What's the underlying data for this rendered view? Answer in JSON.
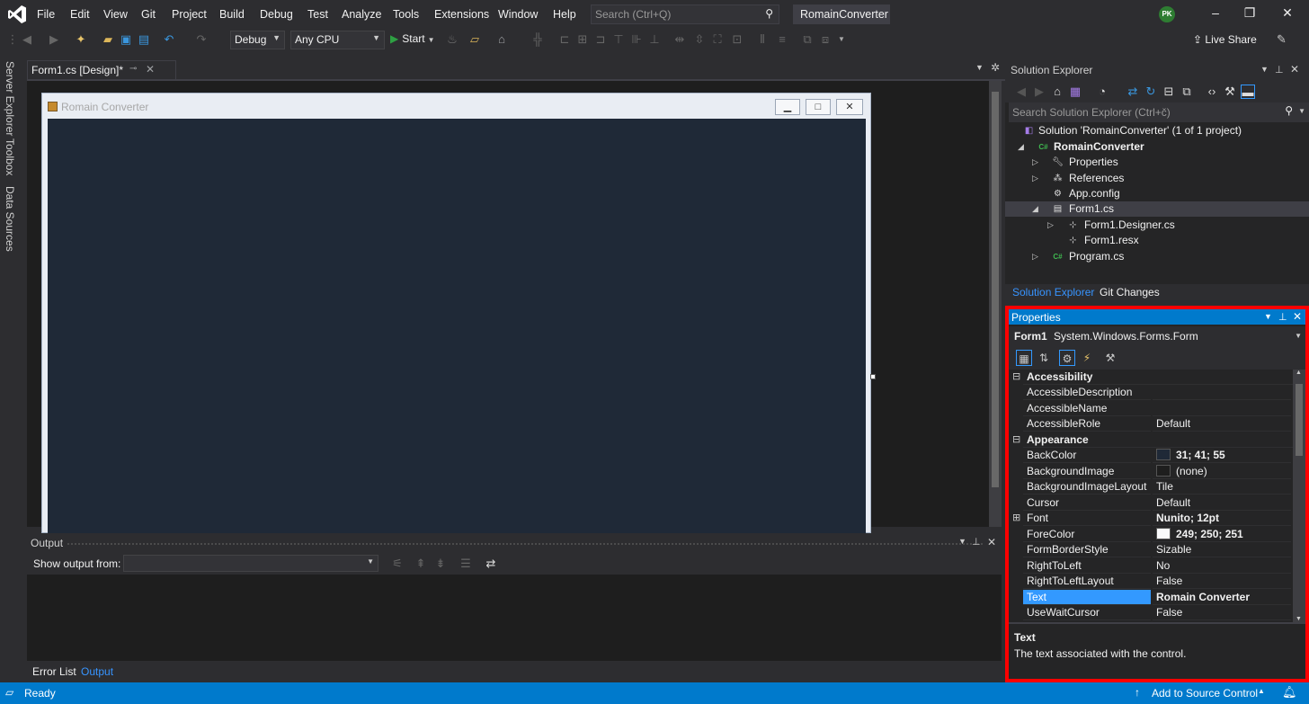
{
  "menu": {
    "items": [
      "File",
      "Edit",
      "View",
      "Git",
      "Project",
      "Build",
      "Debug",
      "Test",
      "Analyze",
      "Tools",
      "Extensions",
      "Window",
      "Help"
    ],
    "search_placeholder": "Search (Ctrl+Q)",
    "solution_name": "RomainConverter",
    "user_initials": "PK"
  },
  "toolbar": {
    "config": "Debug",
    "platform": "Any CPU",
    "start_label": "Start",
    "live_share": "Live Share"
  },
  "left_tabs": [
    "Server Explorer",
    "Toolbox",
    "Data Sources"
  ],
  "document": {
    "tab_label": "Form1.cs [Design]*"
  },
  "form": {
    "title": "Romain Converter",
    "back_color": "#1f2937"
  },
  "output": {
    "title": "Output",
    "show_from_label": "Show output from:",
    "tabs": [
      "Error List",
      "Output"
    ]
  },
  "solution_explorer": {
    "title": "Solution Explorer",
    "search_placeholder": "Search Solution Explorer (Ctrl+č)",
    "tree": [
      {
        "label": "Solution 'RomainConverter' (1 of 1 project)",
        "icon": "solution-icon"
      },
      {
        "label": "RomainConverter",
        "icon": "csharp-project-icon"
      },
      {
        "label": "Properties",
        "icon": "wrench-icon"
      },
      {
        "label": "References",
        "icon": "references-icon"
      },
      {
        "label": "App.config",
        "icon": "config-file-icon"
      },
      {
        "label": "Form1.cs",
        "icon": "form-icon"
      },
      {
        "label": "Form1.Designer.cs",
        "icon": "designer-file-icon"
      },
      {
        "label": "Form1.resx",
        "icon": "resx-file-icon"
      },
      {
        "label": "Program.cs",
        "icon": "csharp-file-icon"
      }
    ],
    "tabs": [
      "Solution Explorer",
      "Git Changes"
    ]
  },
  "properties": {
    "title": "Properties",
    "object_name": "Form1",
    "object_type": "System.Windows.Forms.Form",
    "categories": [
      {
        "name": "Accessibility",
        "rows": [
          {
            "name": "AccessibleDescription",
            "value": ""
          },
          {
            "name": "AccessibleName",
            "value": ""
          },
          {
            "name": "AccessibleRole",
            "value": "Default"
          }
        ]
      },
      {
        "name": "Appearance",
        "rows": [
          {
            "name": "BackColor",
            "value": "31; 41; 55",
            "swatch": "#1f2937",
            "bold": true
          },
          {
            "name": "BackgroundImage",
            "value": "(none)",
            "swatch": "#1e1e1e"
          },
          {
            "name": "BackgroundImageLayout",
            "value": "Tile"
          },
          {
            "name": "Cursor",
            "value": "Default"
          },
          {
            "name": "Font",
            "value": "Nunito; 12pt",
            "bold": true,
            "expandable": true
          },
          {
            "name": "ForeColor",
            "value": "249; 250; 251",
            "swatch": "#f9fafb",
            "bold": true
          },
          {
            "name": "FormBorderStyle",
            "value": "Sizable"
          },
          {
            "name": "RightToLeft",
            "value": "No"
          },
          {
            "name": "RightToLeftLayout",
            "value": "False"
          },
          {
            "name": "Text",
            "value": "Romain Converter",
            "bold": true,
            "selected": true
          },
          {
            "name": "UseWaitCursor",
            "value": "False"
          }
        ]
      }
    ],
    "description_title": "Text",
    "description_text": "The text associated with the control."
  },
  "status": {
    "ready": "Ready",
    "source_control": "Add to Source Control"
  }
}
